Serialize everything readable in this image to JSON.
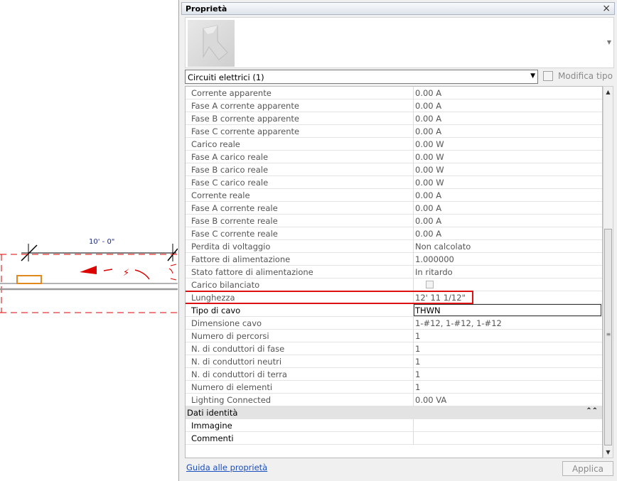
{
  "canvas": {
    "dimension_text": "10' - 0\"",
    "colors": {
      "dimension": "#1c2a80",
      "annotation_red": "#dd0000",
      "fixture": "#e08a1e",
      "wire": "#9a9a9a"
    }
  },
  "palette": {
    "title": "Proprietà",
    "close_icon": "×",
    "type_selector": "Circuiti elettrici (1)",
    "edit_type_label": "Modifica tipo",
    "properties": [
      {
        "name": "Corrente apparente",
        "value": "0.00 A"
      },
      {
        "name": "Fase A corrente apparente",
        "value": "0.00 A"
      },
      {
        "name": "Fase B corrente apparente",
        "value": "0.00 A"
      },
      {
        "name": "Fase C corrente apparente",
        "value": "0.00 A"
      },
      {
        "name": "Carico reale",
        "value": "0.00 W"
      },
      {
        "name": "Fase A carico reale",
        "value": "0.00 W"
      },
      {
        "name": "Fase B carico reale",
        "value": "0.00 W"
      },
      {
        "name": "Fase C carico reale",
        "value": "0.00 W"
      },
      {
        "name": "Corrente reale",
        "value": "0.00 A"
      },
      {
        "name": "Fase A corrente reale",
        "value": "0.00 A"
      },
      {
        "name": "Fase B corrente reale",
        "value": "0.00 A"
      },
      {
        "name": "Fase C corrente reale",
        "value": "0.00 A"
      },
      {
        "name": "Perdita di voltaggio",
        "value": "Non calcolato"
      },
      {
        "name": "Fattore di alimentazione",
        "value": "1.000000"
      },
      {
        "name": "Stato fattore di alimentazione",
        "value": "In ritardo"
      },
      {
        "name": "Carico bilanciato",
        "value": ""
      },
      {
        "name": "Lunghezza",
        "value": "12'  11 1/12\""
      },
      {
        "name": "Tipo di cavo",
        "value": "THWN"
      },
      {
        "name": "Dimensione cavo",
        "value": "1-#12, 1-#12, 1-#12"
      },
      {
        "name": "Numero di percorsi",
        "value": "1"
      },
      {
        "name": "N. di conduttori di fase",
        "value": "1"
      },
      {
        "name": "N. di conduttori neutri",
        "value": "1"
      },
      {
        "name": "N. di conduttori di terra",
        "value": "1"
      },
      {
        "name": "Numero di elementi",
        "value": "1"
      },
      {
        "name": "Lighting Connected",
        "value": "0.00 VA"
      }
    ],
    "group_identity": {
      "label": "Dati identità",
      "collapse_icon": "⌃⌃",
      "properties": [
        {
          "name": "Immagine",
          "value": ""
        },
        {
          "name": "Commenti",
          "value": ""
        }
      ]
    },
    "help_link": "Guida alle proprietà",
    "apply_label": "Applica",
    "highlight_color": "#dd1111"
  }
}
